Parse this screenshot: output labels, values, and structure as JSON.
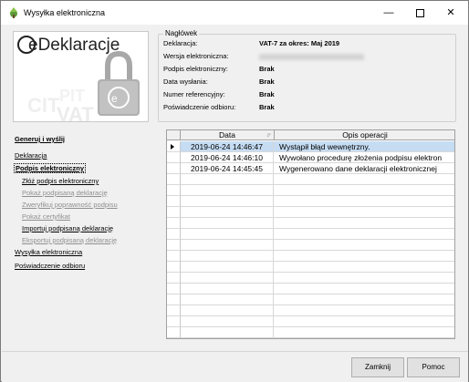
{
  "window": {
    "title": "Wysyłka elektroniczna",
    "minimize_glyph": "—",
    "close_glyph": "✕"
  },
  "logo": {
    "brand_text": "eDeklaracje"
  },
  "header": {
    "legend": "Nagłówek",
    "rows": [
      {
        "label": "Deklaracja:",
        "value": "VAT-7 za okres: Maj 2019"
      },
      {
        "label": "Wersja elektroniczna:",
        "value": ""
      },
      {
        "label": "Podpis elektroniczny:",
        "value": "Brak"
      },
      {
        "label": "Data wysłania:",
        "value": "Brak"
      },
      {
        "label": "Numer referencyjny:",
        "value": "Brak"
      },
      {
        "label": "Poświadczenie odbioru:",
        "value": "Brak"
      }
    ]
  },
  "nav": {
    "items": [
      {
        "label": "Generuj i wyślij"
      },
      {
        "label": "Deklaracja"
      },
      {
        "label": "Podpis elektroniczny"
      },
      {
        "label": "Złóż podpis elektroniczny"
      },
      {
        "label": "Pokaż podpisaną deklarację"
      },
      {
        "label": "Zweryfikuj poprawność podpisu"
      },
      {
        "label": "Pokaż certyfikat"
      },
      {
        "label": "Importuj podpisaną deklarację"
      },
      {
        "label": "Eksportuj podpisaną deklarację"
      },
      {
        "label": "Wysyłka elektroniczna"
      },
      {
        "label": "Poświadczenie odbioru"
      }
    ]
  },
  "grid": {
    "columns": [
      "Data",
      "Opis operacji"
    ],
    "rows": [
      {
        "date": "2019-06-24 14:46:47",
        "desc": "Wystąpił błąd wewnętrzny."
      },
      {
        "date": "2019-06-24 14:46:10",
        "desc": "Wywołano procedurę złożenia podpisu elektron"
      },
      {
        "date": "2019-06-24 14:45:45",
        "desc": "Wygenerowano dane deklaracji elektronicznej"
      }
    ]
  },
  "footer": {
    "ok_label": "Zamknij",
    "help_label": "Pomoc"
  },
  "colors": {
    "selected_row": "#c5dcf3",
    "disabled_link": "#8f8f8f"
  }
}
